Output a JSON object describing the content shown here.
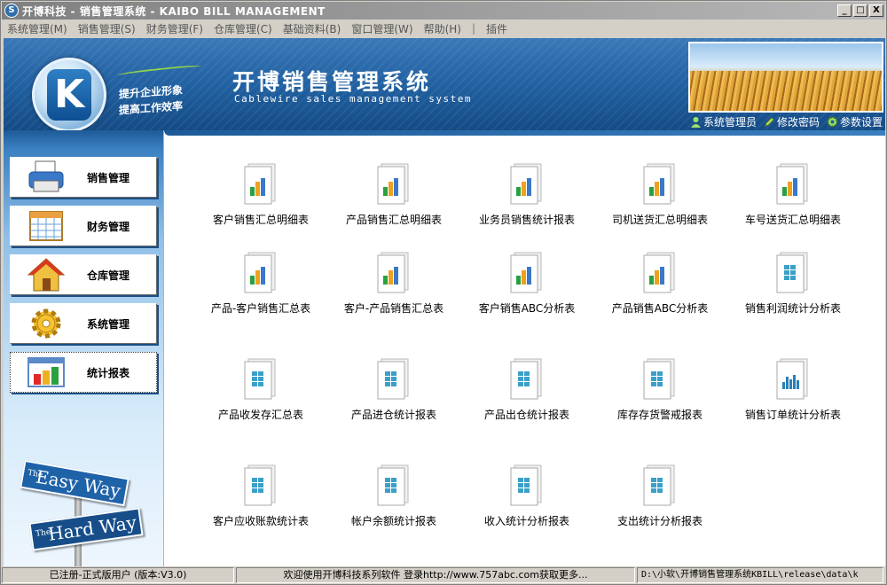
{
  "window": {
    "title": "开博科技 - 销售管理系统 - KAIBO BILL MANAGEMENT",
    "buttons": {
      "minimize": "_",
      "maximize": "□",
      "close": "X"
    }
  },
  "menu": [
    "系统管理(M)",
    "销售管理(S)",
    "财务管理(F)",
    "仓库管理(C)",
    "基础资料(B)",
    "窗口管理(W)",
    "帮助(H)",
    "|",
    "插件"
  ],
  "header": {
    "slogan_1": "提升企业形象",
    "slogan_2": "提高工作效率",
    "app_title": "开博销售管理系统",
    "app_subtitle": "Cablewire sales management system",
    "links": [
      {
        "label": "系统管理员",
        "icon": "user-icon",
        "color": "#7ec850"
      },
      {
        "label": "修改密码",
        "icon": "pencil-icon",
        "color": "#9ad85a"
      },
      {
        "label": "参数设置",
        "icon": "gear-icon",
        "color": "#7ec850"
      }
    ]
  },
  "sidebar": {
    "items": [
      {
        "label": "销售管理",
        "icon": "printer-icon"
      },
      {
        "label": "财务管理",
        "icon": "calendar-grid-icon"
      },
      {
        "label": "仓库管理",
        "icon": "house-icon"
      },
      {
        "label": "系统管理",
        "icon": "gear-icon"
      },
      {
        "label": "统计报表",
        "icon": "bar-chart-icon",
        "active": true
      }
    ],
    "easy_way": {
      "the_1": "The",
      "text_1": "Easy Way",
      "the_2": "The",
      "text_2": "Hard Way"
    }
  },
  "reports": {
    "row1": [
      "客户销售汇总明细表",
      "产品销售汇总明细表",
      "业务员销售统计报表",
      "司机送货汇总明细表",
      "车号送货汇总明细表"
    ],
    "row2": [
      "产品-客户销售汇总表",
      "客户-产品销售汇总表",
      "客户销售ABC分析表",
      "产品销售ABC分析表",
      "销售利润统计分析表"
    ],
    "row3": [
      "产品收发存汇总表",
      "产品进仓统计报表",
      "产品出仓统计报表",
      "库存存货警戒报表",
      "销售订单统计分析表"
    ],
    "row4": [
      "客户应收账款统计表",
      "帐户余额统计报表",
      "收入统计分析报表",
      "支出统计分析报表"
    ]
  },
  "status": {
    "registration": "已注册-正式版用户 (版本:V3.0)",
    "welcome": "欢迎使用开博科技系列软件   登录http://www.757abc.com获取更多...",
    "path": "D:\\小软\\开博销售管理系统KBILL\\release\\data\\k"
  }
}
